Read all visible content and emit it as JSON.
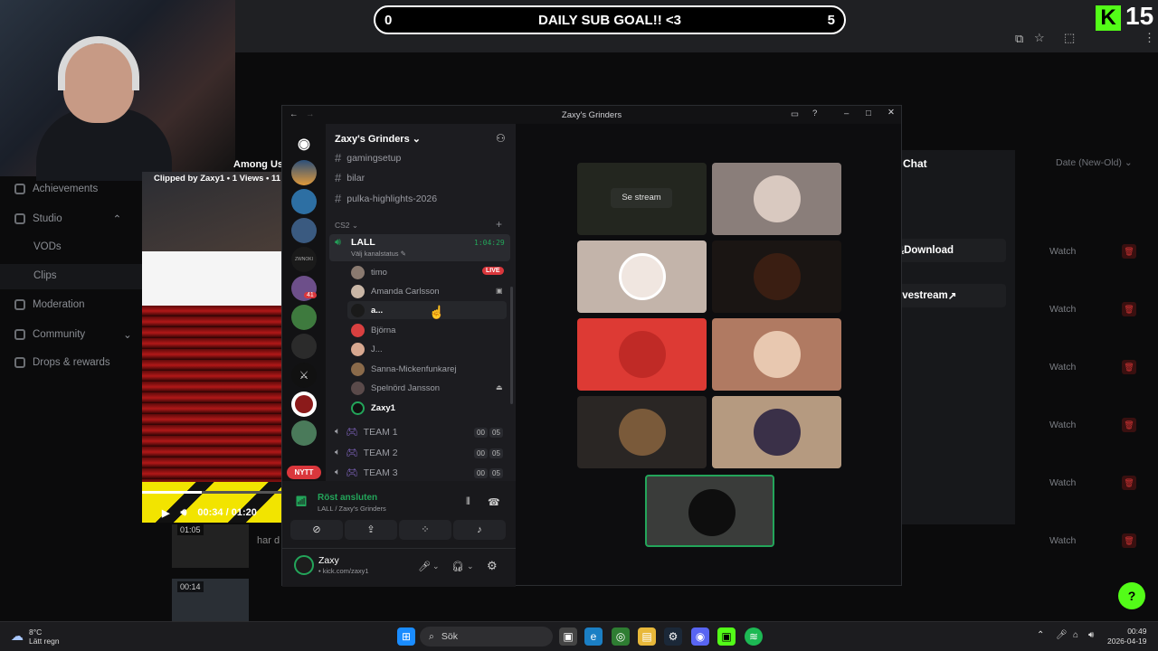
{
  "sub_goal": {
    "left": "0",
    "title": "DAILY SUB GOAL!! <3",
    "right": "5"
  },
  "kick_badge": {
    "letter": "K",
    "count": "15"
  },
  "kick_nav": [
    {
      "label": "Achievements",
      "icon": "trophy-icon"
    },
    {
      "label": "Studio",
      "icon": "studio-icon"
    },
    {
      "label": "VODs",
      "icon": ""
    },
    {
      "label": "Clips",
      "icon": ""
    },
    {
      "label": "Moderation",
      "icon": "sword-icon"
    },
    {
      "label": "Community",
      "icon": "people-icon"
    },
    {
      "label": "Drops & rewards",
      "icon": "gift-icon"
    }
  ],
  "clip": {
    "caption": "Clipped by Zaxy1 • 1 Views • 11",
    "overlay_text": "Among Us",
    "time": "00:34 / 01:20",
    "progress": 0.425
  },
  "thumbs": [
    {
      "time": "01:05"
    },
    {
      "time": "00:14"
    }
  ],
  "row_text": "har d",
  "kick_right": {
    "chat": "Chat",
    "date_sort": "Date (New-Old)",
    "download": "Download",
    "livestream": "ivestream",
    "watch": "Watch"
  },
  "discord": {
    "window_title": "Zaxy's Grinders",
    "server_name": "Zaxy's Grinders",
    "channels": [
      "gamingsetup",
      "bilar",
      "pulka-highlights-2026"
    ],
    "category": "CS2",
    "voice_channel": {
      "name": "LALL",
      "timer": "1:04:29",
      "status": "Välj kanalstatus"
    },
    "voice_users": [
      {
        "name": "timo",
        "badge": "LIVE"
      },
      {
        "name": "Amanda Carlsson",
        "badge": ""
      },
      {
        "name": "a...",
        "badge": ""
      },
      {
        "name": "Björna",
        "badge": ""
      },
      {
        "name": "J...",
        "badge": ""
      },
      {
        "name": "Sanna-Mickenfunkarej",
        "badge": ""
      },
      {
        "name": "Spelnörd Jansson",
        "badge": ""
      },
      {
        "name": "Zaxy1",
        "badge": ""
      }
    ],
    "teams": [
      {
        "name": "TEAM 1",
        "a": "00",
        "b": "05"
      },
      {
        "name": "TEAM 2",
        "a": "00",
        "b": "05"
      },
      {
        "name": "TEAM 3",
        "a": "00",
        "b": "05"
      }
    ],
    "nytt_badge": "NYTT",
    "server_badge": "41",
    "voice_connected": "Röst ansluten",
    "voice_location": "LALL / Zaxy's Grinders",
    "user_name": "Zaxy",
    "user_status": "• kick.com/zaxy1",
    "se_stream": "Se stream"
  },
  "taskbar": {
    "search": "Sök",
    "weather_temp": "8°C",
    "weather_desc": "Lätt regn",
    "time": "00:49",
    "date": "2026-04-19"
  },
  "colors": {
    "kick_green": "#53fc18",
    "live_red": "#da373c",
    "voice_green": "#23a55a"
  }
}
